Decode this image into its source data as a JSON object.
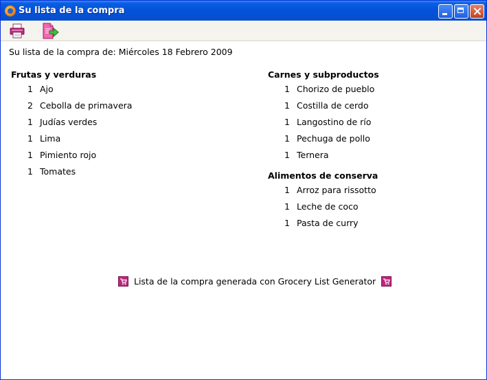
{
  "window": {
    "title": "Su lista de la compra"
  },
  "toolbar": {
    "buttons": [
      {
        "icon": "printer-icon"
      },
      {
        "icon": "export-document-icon"
      }
    ]
  },
  "header": {
    "date_line": "Su lista de la compra de: Miércoles 18 Febrero 2009"
  },
  "categories": [
    {
      "name": "Frutas y verduras",
      "items": [
        {
          "qty": "1",
          "name": "Ajo"
        },
        {
          "qty": "2",
          "name": "Cebolla de primavera"
        },
        {
          "qty": "1",
          "name": "Judías verdes"
        },
        {
          "qty": "1",
          "name": "Lima"
        },
        {
          "qty": "1",
          "name": "Pimiento rojo"
        },
        {
          "qty": "1",
          "name": "Tomates"
        }
      ]
    },
    {
      "name": "Carnes y subproductos",
      "items": [
        {
          "qty": "1",
          "name": "Chorizo de pueblo"
        },
        {
          "qty": "1",
          "name": "Costilla de cerdo"
        },
        {
          "qty": "1",
          "name": "Langostino de río"
        },
        {
          "qty": "1",
          "name": "Pechuga de pollo"
        },
        {
          "qty": "1",
          "name": "Ternera"
        }
      ]
    },
    {
      "name": "Alimentos de conserva",
      "items": [
        {
          "qty": "1",
          "name": "Arroz para rissotto"
        },
        {
          "qty": "1",
          "name": "Leche de coco"
        },
        {
          "qty": "1",
          "name": "Pasta de curry"
        }
      ]
    }
  ],
  "footer": {
    "text": "Lista de la compra generada con Grocery List Generator",
    "icon": "shopping-cart-icon"
  },
  "colors": {
    "title_bar": "#0453dc",
    "close_button": "#c2401f",
    "toolbar_bg": "#f4f3ee",
    "icon_magenta": "#c0267e"
  }
}
